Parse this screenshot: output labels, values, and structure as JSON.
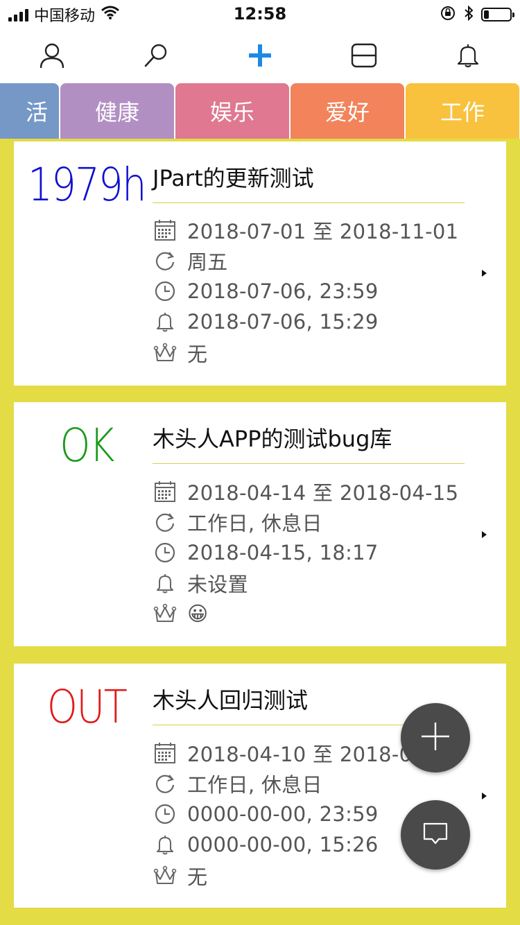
{
  "status_bar": {
    "carrier": "中国移动",
    "time": "12:58",
    "battery_level": 0.2
  },
  "toolbar": {
    "icons": [
      "profile-icon",
      "search-icon",
      "add-icon",
      "split-view-icon",
      "bell-icon"
    ],
    "accent": "#1e88e5"
  },
  "tabs": [
    {
      "label": "活",
      "color": "#7598c7"
    },
    {
      "label": "健康",
      "color": "#b28fc3"
    },
    {
      "label": "娱乐",
      "color": "#df7890"
    },
    {
      "label": "爱好",
      "color": "#f2835b"
    },
    {
      "label": "工作",
      "color": "#f8c23e"
    }
  ],
  "cards": [
    {
      "badge": "1979h",
      "badge_color": "#1010d0",
      "title": "JPart的更新测试",
      "date_range": "2018-07-01 至 2018-11-01",
      "repeat": "周五",
      "deadline": "2018-07-06, 23:59",
      "reminder": "2018-07-06, 15:29",
      "priority": "无"
    },
    {
      "badge": "OK",
      "badge_color": "#1a9a1a",
      "title": "木头人APP的测试bug库",
      "date_range": "2018-04-14 至 2018-04-15",
      "repeat": "工作日, 休息日",
      "deadline": "2018-04-15, 18:17",
      "reminder": "未设置",
      "priority": "😀"
    },
    {
      "badge": "OUT",
      "badge_color": "#e01b1b",
      "title": "木头人回归测试",
      "date_range": "2018-04-10 至 2018-04",
      "repeat": "工作日, 休息日",
      "deadline": "0000-00-00, 23:59",
      "reminder": "0000-00-00, 15:26",
      "priority": "无"
    }
  ],
  "fabs": {
    "add": "add-fab-icon",
    "message": "message-fab-icon"
  }
}
